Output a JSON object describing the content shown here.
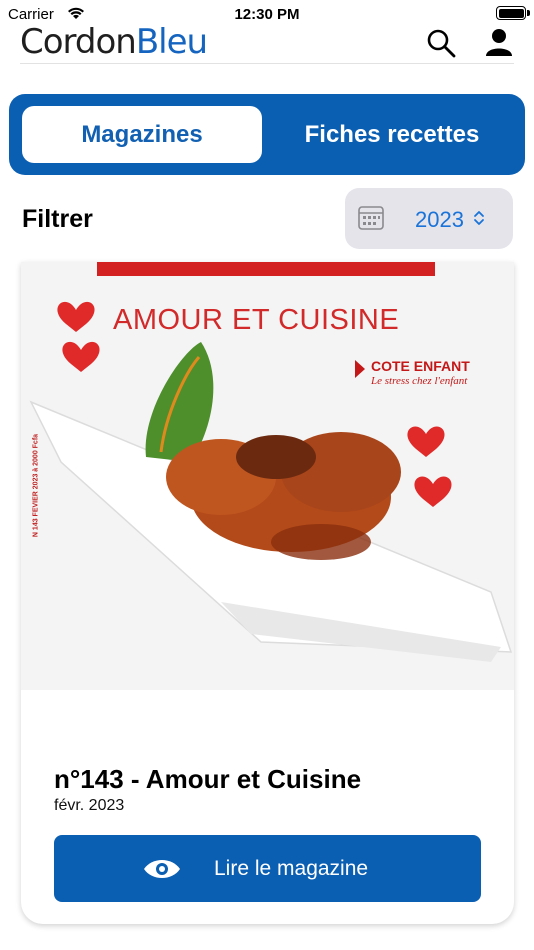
{
  "status_bar": {
    "carrier": "Carrier",
    "time": "12:30 PM"
  },
  "header": {
    "logo_part1": "Cordon",
    "logo_part2": "Bleu"
  },
  "tabs": [
    {
      "label": "Magazines",
      "selected": true
    },
    {
      "label": "Fiches recettes",
      "selected": false
    }
  ],
  "filter": {
    "label": "Filtrer",
    "year": "2023"
  },
  "magazine": {
    "cover_title": "AMOUR ET CUISINE",
    "cover_side_text": "N 143 FEVIER 2023 à 2000 Fcfa",
    "cover_feature_title": "COTE ENFANT",
    "cover_feature_sub": "Le stress chez l'enfant",
    "title": "n°143 - Amour et Cuisine",
    "date": "févr. 2023",
    "read_label": "Lire le magazine"
  },
  "colors": {
    "brand_blue": "#0b5fb3",
    "accent_blue": "#1a73d9",
    "cover_red": "#d22a2a"
  }
}
